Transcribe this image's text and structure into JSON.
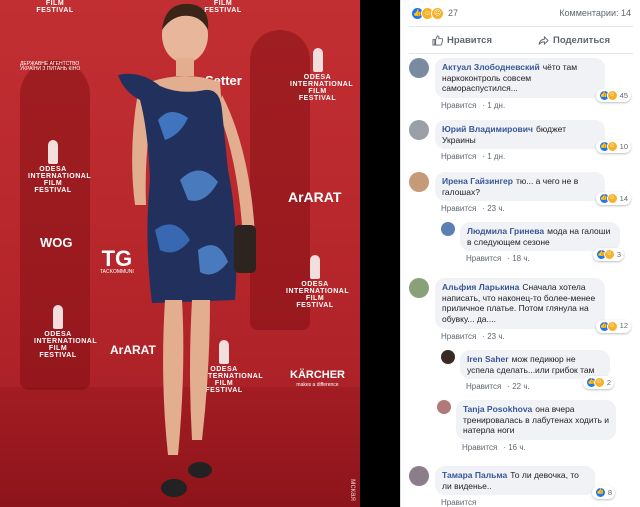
{
  "photo": {
    "logos": {
      "ooff_line1": "Odesa",
      "ooff_line2": "International",
      "ooff_line3": "Film Festival",
      "ararat": "ArARAT",
      "tg": "TG",
      "tg_sub": "TACKOMMUNI",
      "wog": "WOG",
      "karcher": "KÄRCHER",
      "karcher_sub": "makes a difference",
      "megogo": "Setter",
      "gov_agency": "ДЕРЖАВНЕ АГЕНТСТВО УКРАЇНИ З ПИТАНЬ КІНО",
      "side_mark": "мская"
    }
  },
  "post": {
    "reaction_count": "27",
    "comments_label": "Комментарии: 14",
    "like_action": "Нравится",
    "share_action": "Поделиться"
  },
  "comments": [
    {
      "name": "Актуал Злободневский",
      "text": "чёто там наркоконтроль совсем самораспустился...",
      "like": "Нравится",
      "time": "1 дн.",
      "reactions": "45",
      "avatar_color": "#7a8aa0"
    },
    {
      "name": "Юрий Владимирович",
      "text": "бюджет Украины",
      "like": "Нравится",
      "time": "1 дн.",
      "reactions": "10",
      "avatar_color": "#9aa0a8"
    },
    {
      "name": "Ирена Гайзингер",
      "text": "тю... а чего не в галошах?",
      "like": "Нравится",
      "time": "23 ч.",
      "reactions": "14",
      "avatar_color": "#c49a78"
    },
    {
      "name": "Людмила Гринева",
      "text": "мода на галоши в следующем сезоне",
      "like": "Нравится",
      "time": "18 ч.",
      "reactions": "3",
      "avatar_color": "#5b7fb3"
    },
    {
      "name": "Альфия Ларькина",
      "text": "Сначала хотела написать, что наконец-то более-менее приличное платье. Потом глянула на обувку... да....",
      "like": "Нравится",
      "time": "23 ч.",
      "reactions": "12",
      "avatar_color": "#8aa07a"
    },
    {
      "name": "Iren Saher",
      "text": "мож педикюр не успела сделать...или грибок там",
      "like": "Нравится",
      "time": "22 ч.",
      "reactions": "2",
      "avatar_color": "#3a2a24"
    },
    {
      "name": "Tanja Posokhova",
      "text": "она вчера тренировалась в лабутенах ходить и натерла ноги",
      "like": "Нравится",
      "time": "16 ч.",
      "reactions": "",
      "avatar_color": "#b07a7a"
    },
    {
      "name": "Тамара Пальма",
      "text": "То ли девочка, то ли виденье..",
      "like": "Нравится",
      "time": "",
      "reactions": "8",
      "avatar_color": "#8c7d8a"
    }
  ]
}
